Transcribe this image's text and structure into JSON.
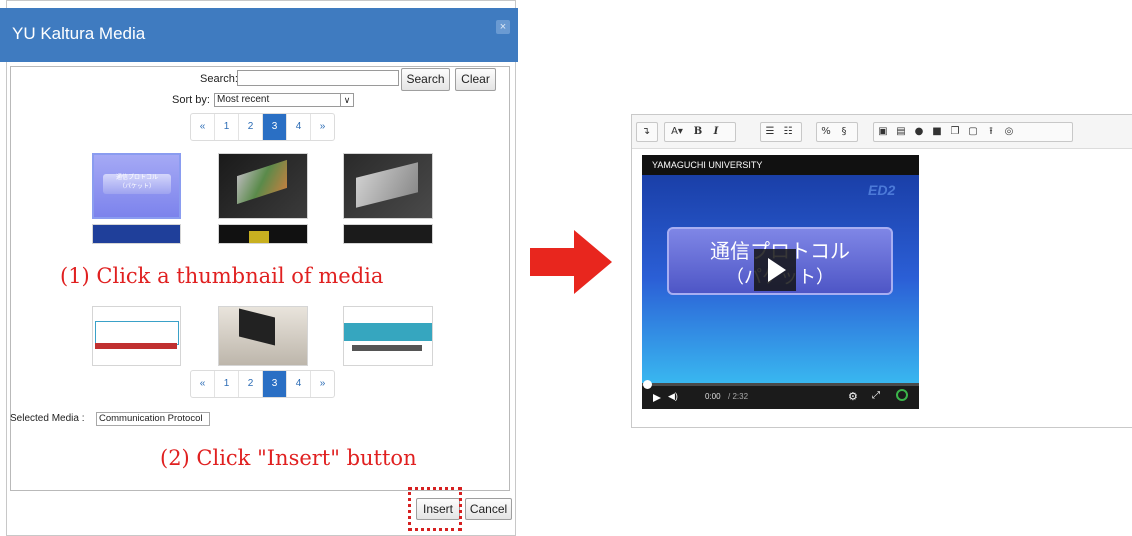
{
  "dialog": {
    "title": "YU Kaltura Media",
    "close_glyph": "×",
    "search_label": "Search:",
    "search_value": "",
    "search_button": "Search",
    "clear_button": "Clear",
    "sort_label": "Sort by:",
    "sort_value": "Most recent",
    "pager": {
      "items": [
        "«",
        "1",
        "2",
        "3",
        "4",
        "»"
      ],
      "active": "3"
    },
    "selected_media_label": "Selected Media :",
    "selected_media_value": "Communication Protocol",
    "insert_button": "Insert",
    "cancel_button": "Cancel",
    "first_thumbnail_text": "通信プロトコル\n（パケット）"
  },
  "instructions": {
    "step1": "(1) Click a thumbnail of media",
    "step2": "(2) Click \"Insert\" button"
  },
  "editor": {
    "toolbar_icons": [
      "indent-icon",
      "font-color-icon",
      "bold-icon",
      "italic-icon",
      "bullet-list-icon",
      "numbered-list-icon",
      "link-icon",
      "unlink-icon",
      "image-icon",
      "media-icon",
      "record-audio-icon",
      "record-video-icon",
      "manage-files-icon",
      "h5p-icon",
      "upload-icon",
      "embed-icon"
    ],
    "video": {
      "university_label": "YAMAGUCHI UNIVERSITY",
      "slide_title": "通信プロトコル",
      "slide_subtitle": "（パケット）",
      "time_current": "0:00",
      "time_total": "/ 2:32"
    }
  },
  "colors": {
    "titlebar": "#3f7bc0",
    "pager_active": "#2a6fc4",
    "annotation": "#e02020",
    "arrow": "#e8261e"
  }
}
